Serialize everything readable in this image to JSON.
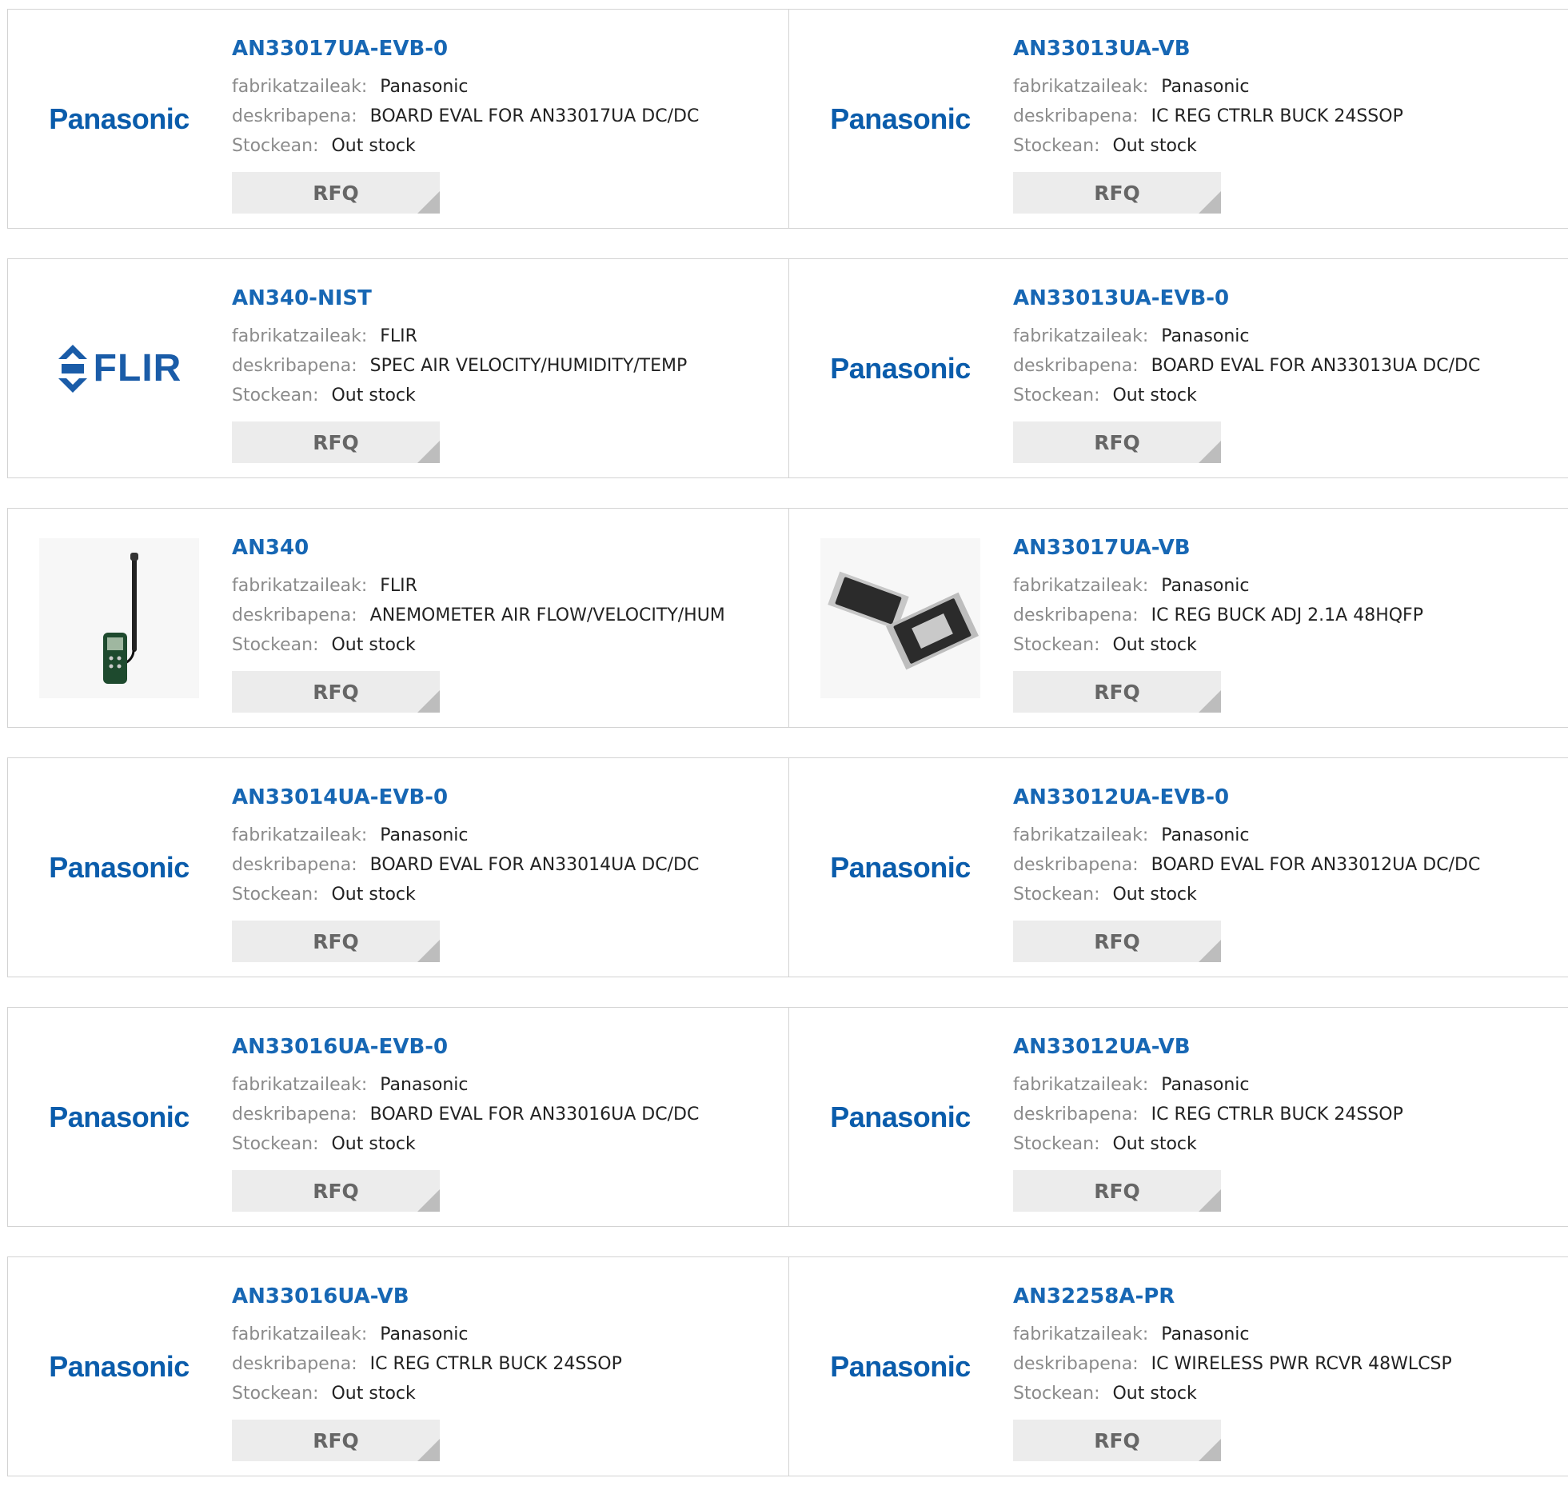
{
  "labels": {
    "manufacturer": "fabrikatzaileak:",
    "description": "deskribapena:",
    "stock": "Stockean:",
    "rfq": "RFQ"
  },
  "colors": {
    "link": "#1767b4",
    "panasonic_logo": "#0a5cab",
    "flir_logo": "#1a5ca8"
  },
  "products": [
    {
      "part": "AN33017UA-EVB-0",
      "manufacturer": "Panasonic",
      "description": "BOARD EVAL FOR AN33017UA DC/DC",
      "stock": "Out stock",
      "image": "panasonic-logo",
      "brand": "Panasonic"
    },
    {
      "part": "AN33013UA-VB",
      "manufacturer": "Panasonic",
      "description": "IC REG CTRLR BUCK 24SSOP",
      "stock": "Out stock",
      "image": "panasonic-logo",
      "brand": "Panasonic"
    },
    {
      "part": "AN340-NIST",
      "manufacturer": "FLIR",
      "description": "SPEC AIR VELOCITY/HUMIDITY/TEMP",
      "stock": "Out stock",
      "image": "flir-logo",
      "brand": "FLIR"
    },
    {
      "part": "AN33013UA-EVB-0",
      "manufacturer": "Panasonic",
      "description": "BOARD EVAL FOR AN33013UA DC/DC",
      "stock": "Out stock",
      "image": "panasonic-logo",
      "brand": "Panasonic"
    },
    {
      "part": "AN340",
      "manufacturer": "FLIR",
      "description": "ANEMOMETER AIR FLOW/VELOCITY/HUM",
      "stock": "Out stock",
      "image": "anemometer-photo",
      "brand": ""
    },
    {
      "part": "AN33017UA-VB",
      "manufacturer": "Panasonic",
      "description": "IC REG BUCK ADJ 2.1A 48HQFP",
      "stock": "Out stock",
      "image": "chip-photo",
      "brand": ""
    },
    {
      "part": "AN33014UA-EVB-0",
      "manufacturer": "Panasonic",
      "description": "BOARD EVAL FOR AN33014UA DC/DC",
      "stock": "Out stock",
      "image": "panasonic-logo",
      "brand": "Panasonic"
    },
    {
      "part": "AN33012UA-EVB-0",
      "manufacturer": "Panasonic",
      "description": "BOARD EVAL FOR AN33012UA DC/DC",
      "stock": "Out stock",
      "image": "panasonic-logo",
      "brand": "Panasonic"
    },
    {
      "part": "AN33016UA-EVB-0",
      "manufacturer": "Panasonic",
      "description": "BOARD EVAL FOR AN33016UA DC/DC",
      "stock": "Out stock",
      "image": "panasonic-logo",
      "brand": "Panasonic"
    },
    {
      "part": "AN33012UA-VB",
      "manufacturer": "Panasonic",
      "description": "IC REG CTRLR BUCK 24SSOP",
      "stock": "Out stock",
      "image": "panasonic-logo",
      "brand": "Panasonic"
    },
    {
      "part": "AN33016UA-VB",
      "manufacturer": "Panasonic",
      "description": "IC REG CTRLR BUCK 24SSOP",
      "stock": "Out stock",
      "image": "panasonic-logo",
      "brand": "Panasonic"
    },
    {
      "part": "AN32258A-PR",
      "manufacturer": "Panasonic",
      "description": "IC WIRELESS PWR RCVR 48WLCSP",
      "stock": "Out stock",
      "image": "panasonic-logo",
      "brand": "Panasonic"
    }
  ]
}
